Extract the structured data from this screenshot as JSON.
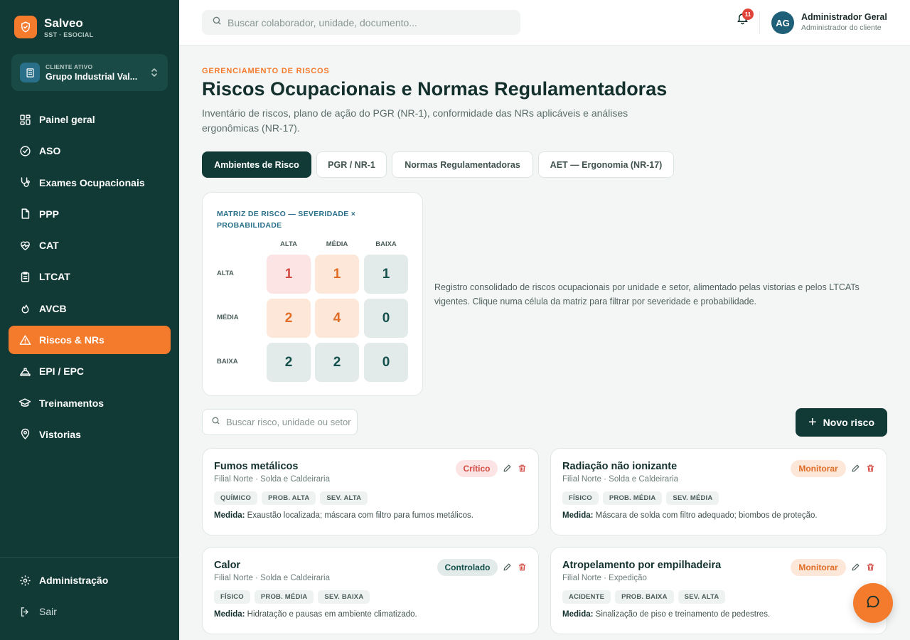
{
  "brand": {
    "name": "Salveo",
    "subtitle": "SST · ESOCIAL"
  },
  "client": {
    "label": "CLIENTE ATIVO",
    "name": "Grupo Industrial Val..."
  },
  "nav": [
    {
      "label": "Painel geral",
      "icon": "grid-icon"
    },
    {
      "label": "ASO",
      "icon": "check-circle-icon"
    },
    {
      "label": "Exames Ocupacionais",
      "icon": "stethoscope-icon"
    },
    {
      "label": "PPP",
      "icon": "file-icon"
    },
    {
      "label": "CAT",
      "icon": "heart-pulse-icon"
    },
    {
      "label": "LTCAT",
      "icon": "clipboard-icon"
    },
    {
      "label": "AVCB",
      "icon": "flame-icon"
    },
    {
      "label": "Riscos & NRs",
      "icon": "warning-icon",
      "active": true
    },
    {
      "label": "EPI / EPC",
      "icon": "hard-hat-icon"
    },
    {
      "label": "Treinamentos",
      "icon": "graduation-cap-icon"
    },
    {
      "label": "Vistorias",
      "icon": "map-pin-icon"
    }
  ],
  "bottom_nav": {
    "admin": "Administração",
    "logout": "Sair"
  },
  "topbar": {
    "search_placeholder": "Buscar colaborador, unidade, documento...",
    "notifications": "11",
    "user_initials": "AG",
    "user_name": "Administrador Geral",
    "user_role": "Administrador do cliente"
  },
  "header": {
    "eyebrow": "GERENCIAMENTO DE RISCOS",
    "title": "Riscos Ocupacionais e Normas Regulamentadoras",
    "description": "Inventário de riscos, plano de ação do PGR (NR-1), conformidade das NRs aplicáveis e análises ergonômicas (NR-17)."
  },
  "tabs": [
    "Ambientes de Risco",
    "PGR / NR-1",
    "Normas Regulamentadoras",
    "AET — Ergonomia (NR-17)"
  ],
  "matrix": {
    "title": "MATRIZ DE RISCO — SEVERIDADE × PROBABILIDADE",
    "columns": [
      "ALTA",
      "MÉDIA",
      "BAIXA"
    ],
    "rows": [
      "ALTA",
      "MÉDIA",
      "BAIXA"
    ],
    "values": [
      [
        "1",
        "1",
        "1"
      ],
      [
        "2",
        "4",
        "0"
      ],
      [
        "2",
        "2",
        "0"
      ]
    ],
    "note": "Registro consolidado de riscos ocupacionais por unidade e setor, alimentado pelas vistorias e pelos LTCATs vigentes. Clique numa célula da matriz para filtrar por severidade e probabilidade."
  },
  "list": {
    "search_placeholder": "Buscar risco, unidade ou setor",
    "new_button": "Novo risco"
  },
  "risks": [
    {
      "name": "Fumos metálicos",
      "location": "Filial Norte · Solda e Caldeiraria",
      "status": "Crítico",
      "tags": [
        "QUÍMICO",
        "PROB. ALTA",
        "SEV. ALTA"
      ],
      "measure_label": "Medida:",
      "measure": "Exaustão localizada; máscara com filtro para fumos metálicos."
    },
    {
      "name": "Radiação não ionizante",
      "location": "Filial Norte · Solda e Caldeiraria",
      "status": "Monitorar",
      "tags": [
        "FÍSICO",
        "PROB. MÉDIA",
        "SEV. MÉDIA"
      ],
      "measure_label": "Medida:",
      "measure": "Máscara de solda com filtro adequado; biombos de proteção."
    },
    {
      "name": "Calor",
      "location": "Filial Norte · Solda e Caldeiraria",
      "status": "Controlado",
      "tags": [
        "FÍSICO",
        "PROB. MÉDIA",
        "SEV. BAIXA"
      ],
      "measure_label": "Medida:",
      "measure": "Hidratação e pausas em ambiente climatizado."
    },
    {
      "name": "Atropelamento por empilhadeira",
      "location": "Filial Norte · Expedição",
      "status": "Monitorar",
      "tags": [
        "ACIDENTE",
        "PROB. BAIXA",
        "SEV. ALTA"
      ],
      "measure_label": "Medida:",
      "measure": "Sinalização de piso e treinamento de pedestres."
    }
  ],
  "colors": {
    "sidebar": "#113a36",
    "accent": "#f47a2c",
    "critical": "#d24a43",
    "monitor": "#e06c26",
    "controlled": "#14504b"
  }
}
